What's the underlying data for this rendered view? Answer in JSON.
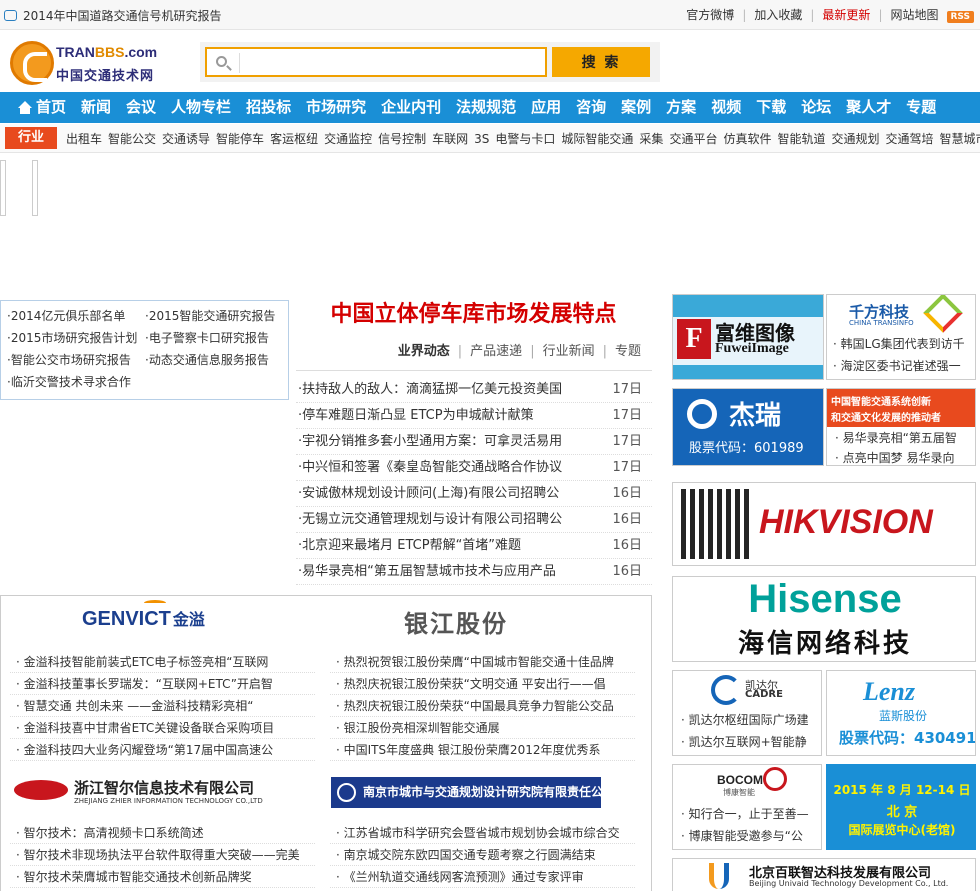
{
  "topbar": {
    "notice": "2014年中国道路交通信号机研究报告",
    "links": [
      "官方微博",
      "加入收藏",
      "最新更新",
      "网站地图"
    ],
    "rss": "RSS"
  },
  "logo": {
    "en_a": "TRAN",
    "en_b": "BBS",
    "en_c": ".com",
    "cn": "中国交通技术网"
  },
  "search": {
    "value": "",
    "button": "搜 索"
  },
  "nav": [
    "首页",
    "新闻",
    "会议",
    "人物专栏",
    "招投标",
    "市场研究",
    "企业内刊",
    "法规规范",
    "应用",
    "咨询",
    "案例",
    "方案",
    "视频",
    "下载",
    "论坛",
    "聚人才",
    "专题"
  ],
  "industry": {
    "tag": "行业",
    "items": [
      "出租车",
      "智能公交",
      "交通诱导",
      "智能停车",
      "客运枢纽",
      "交通监控",
      "信号控制",
      "车联网",
      "3S",
      "电警与卡口",
      "城际智能交通",
      "采集",
      "交通平台",
      "仿真软件",
      "智能轨道",
      "交通规划",
      "交通驾培",
      "智慧城市"
    ]
  },
  "leftbox": [
    "·2014亿元俱乐部名单",
    "·2015智能交通研究报告",
    "·2015市场研究报告计划",
    "·电子警察卡口研究报告",
    "·智能公交市场研究报告",
    "·动态交通信息服务报告",
    "·临沂交警技术寻求合作"
  ],
  "headline": "中国立体停车库市场发展特点",
  "tabs": [
    "业界动态",
    "产品速递",
    "行业新闻",
    "专题"
  ],
  "news": [
    {
      "title": "·扶持敌人的敌人：滴滴猛掷一亿美元投资美国",
      "date": "17日"
    },
    {
      "title": "·停车难题日渐凸显 ETCP为申城献计献策",
      "date": "17日"
    },
    {
      "title": "·宇视分销推多套小型通用方案：可拿灵活易用",
      "date": "17日"
    },
    {
      "title": "·中兴恒和签署《秦皇岛智能交通战略合作协议",
      "date": "17日"
    },
    {
      "title": "·安诚傲林规划设计顾问(上海)有限公司招聘公",
      "date": "16日"
    },
    {
      "title": "·无锡立沅交通管理规划与设计有限公司招聘公",
      "date": "16日"
    },
    {
      "title": "·北京迎来最堵月 ETCP帮解“首堵”难题",
      "date": "16日"
    },
    {
      "title": "·易华录亮相“第五届智慧城市技术与应用产品",
      "date": "16日"
    }
  ],
  "companies": {
    "genvict": {
      "logo": "GENVICT",
      "logo_cn": "金溢",
      "items": [
        "· 金溢科技智能前装式ETC电子标签亮相“互联网",
        "· 金溢科技董事长罗瑞发：“互联网+ETC”开启智",
        "· 智慧交通 共创未来 ——金溢科技精彩亮相“",
        "· 金溢科技喜中甘肃省ETC关键设备联合采购项目",
        "· 金溢科技四大业务闪耀登场“第17届中国高速公"
      ]
    },
    "yinjiang": {
      "logo": "银江股份",
      "items": [
        "· 热烈祝贺银江股份荣膺“中国城市智能交通十佳品牌",
        "· 热烈庆祝银江股份荣获“文明交通 平安出行——倡",
        "· 热烈庆祝银江股份荣获“中国最具竞争力智能公交品",
        "· 银江股份亮相深圳智能交通展",
        "· 中国ITS年度盛典 银江股份荣膺2012年度优秀系"
      ]
    },
    "zhier": {
      "logo": "浙江智尔信息技术有限公司",
      "logo_en": "ZHEJIANG ZHIER INFORMATION TECHNOLOGY CO.,LTD",
      "items": [
        "· 智尔技术：高清视频卡口系统简述",
        "· 智尔技术非现场执法平台软件取得重大突破——完美",
        "· 智尔技术荣膺城市智能交通技术创新品牌奖"
      ]
    },
    "nanjing": {
      "logo": "南京市城市与交通规划设计研究院有限责任公司",
      "items": [
        "· 江苏省城市科学研究会暨省城市规划协会城市综合交",
        "· 南京城交院东欧四国交通专题考察之行圆满结束",
        "· 《兰州轨道交通线网客流预测》通过专家评审"
      ]
    }
  },
  "ads": {
    "fuwei": {
      "cn": "富维图像",
      "en": "FuweiImage"
    },
    "qianfang": {
      "cn": "千方科技",
      "en": "CHINA TRANSINFO",
      "items": [
        "· 韩国LG集团代表到访千",
        "· 海淀区委书记崔述强一"
      ]
    },
    "jierui": {
      "name": "杰瑞",
      "code": "股票代码：601989"
    },
    "its": {
      "line1": "中国智能交通系统创新",
      "line2": "和交通文化发展的推动者",
      "items": [
        "· 易华录亮相“第五届智",
        "· 点亮中国梦 易华录向"
      ]
    },
    "hik": {
      "name": "HIKVISION"
    },
    "hisense": {
      "en": "Hisense",
      "cn": "海信网络科技"
    },
    "cadre": {
      "cn": "凯达尔",
      "en": "CADRE",
      "items": [
        "· 凯达尔枢纽国际广场建",
        "· 凯达尔互联网+智能静"
      ]
    },
    "lenz": {
      "en": "Lenz",
      "cn": "蓝斯股份",
      "code": "股票代码：430491"
    },
    "bocom": {
      "name": "BOCOM",
      "cn": "博康智能",
      "items": [
        "· 知行合一，止于至善—",
        "· 博康智能受邀参与“公"
      ]
    },
    "expo": {
      "line1": "2015 年 8 月 12-14 日",
      "line2": "北  京",
      "line3": "国际展览中心(老馆)"
    },
    "unividi": {
      "cn": "北京百联智达科技发展有限公司",
      "en": "Beijing Univaid Technology Development Co., Ltd."
    }
  },
  "colors": {
    "nav": "#1a8fd6",
    "accent": "#d40000",
    "orange": "#f5a800",
    "tag": "#e84a1e"
  }
}
